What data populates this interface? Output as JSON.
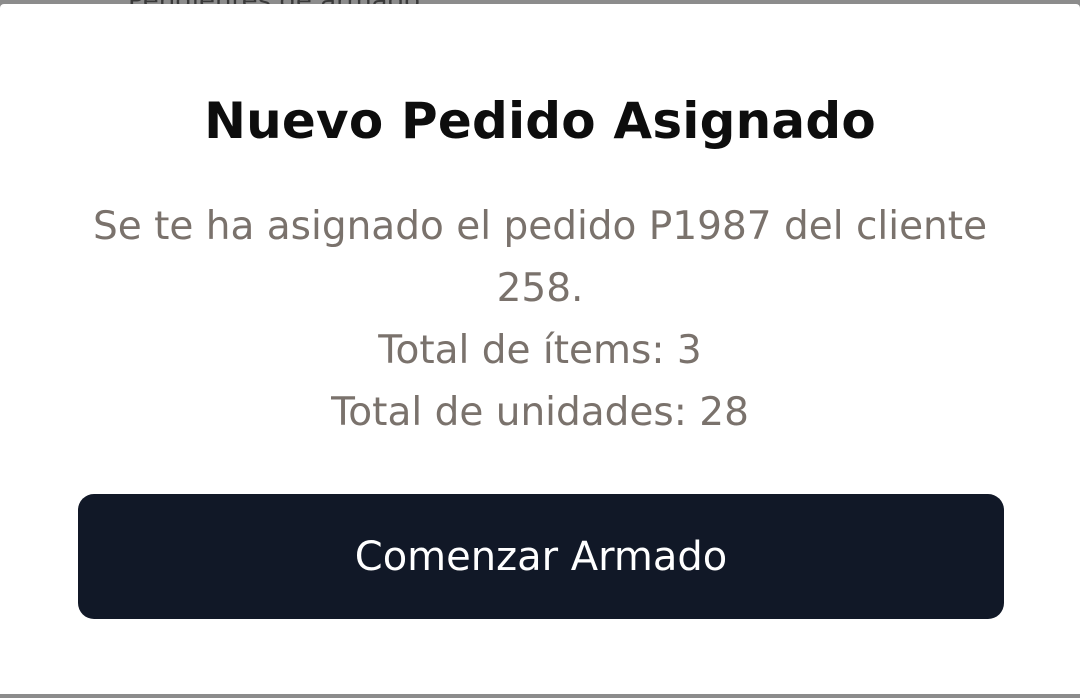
{
  "background": {
    "peek_text": "Pendientes de armado"
  },
  "dialog": {
    "title": "Nuevo Pedido Asignado",
    "message": "Se te ha asignado el pedido P1987 del cliente 258.",
    "items_line": "Total de ítems: 3",
    "units_line": "Total de unidades: 28",
    "button_label": "Comenzar Armado"
  },
  "colors": {
    "button_bg": "#111827",
    "title": "#0d0d0d",
    "body_text": "#7a726c",
    "dialog_bg": "#ffffff"
  }
}
